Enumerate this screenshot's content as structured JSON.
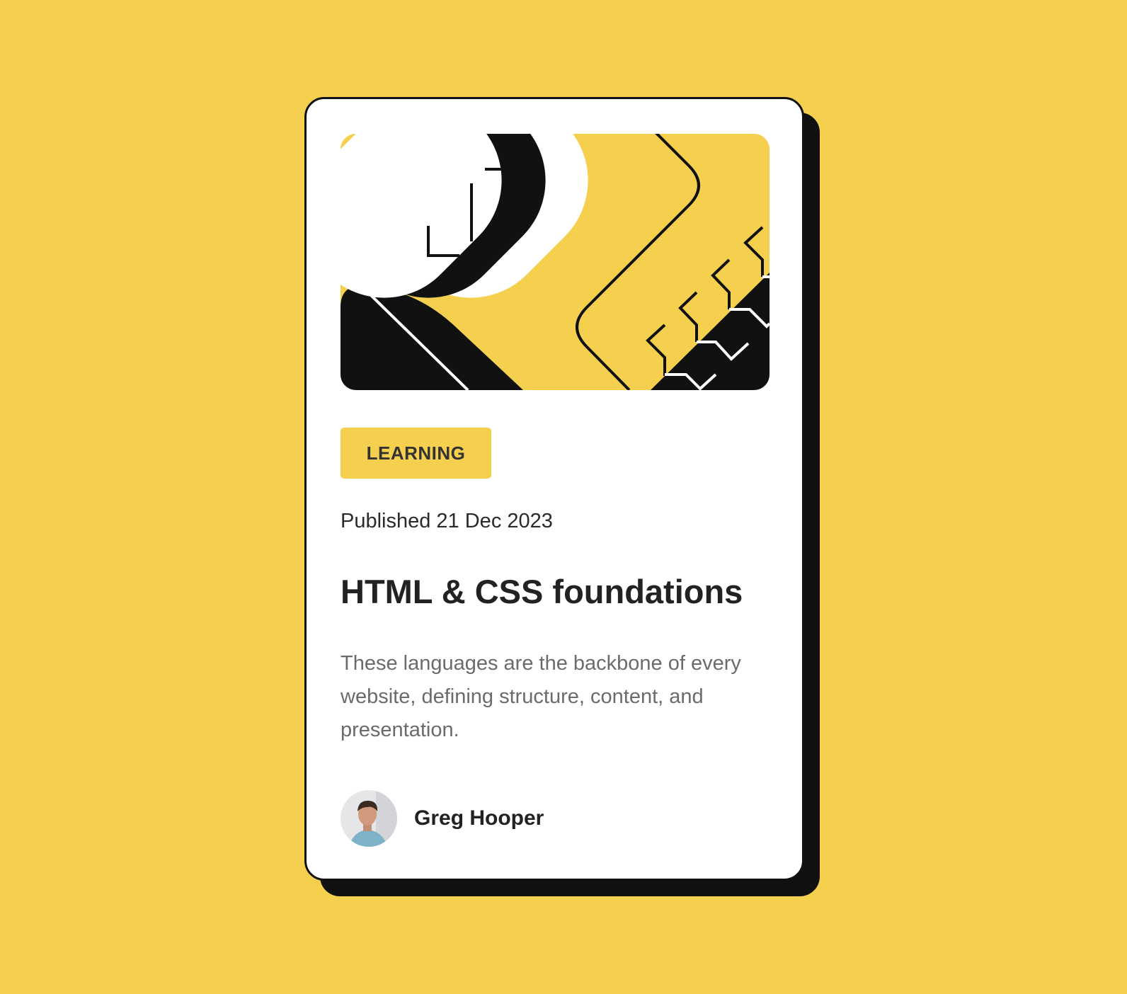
{
  "colors": {
    "background": "#F4D04E",
    "card": "#FFFFFF",
    "ink": "#111111",
    "text_dark": "#222222",
    "text_muted": "#6B6B6B"
  },
  "card": {
    "illustration": "abstract-geometric-illustration",
    "tag": "LEARNING",
    "published": "Published 21 Dec 2023",
    "title": "HTML & CSS foundations",
    "description": "These languages are the backbone of every website, defining structure, content, and presentation.",
    "author": {
      "name": "Greg Hooper",
      "avatar": "person-avatar"
    }
  }
}
